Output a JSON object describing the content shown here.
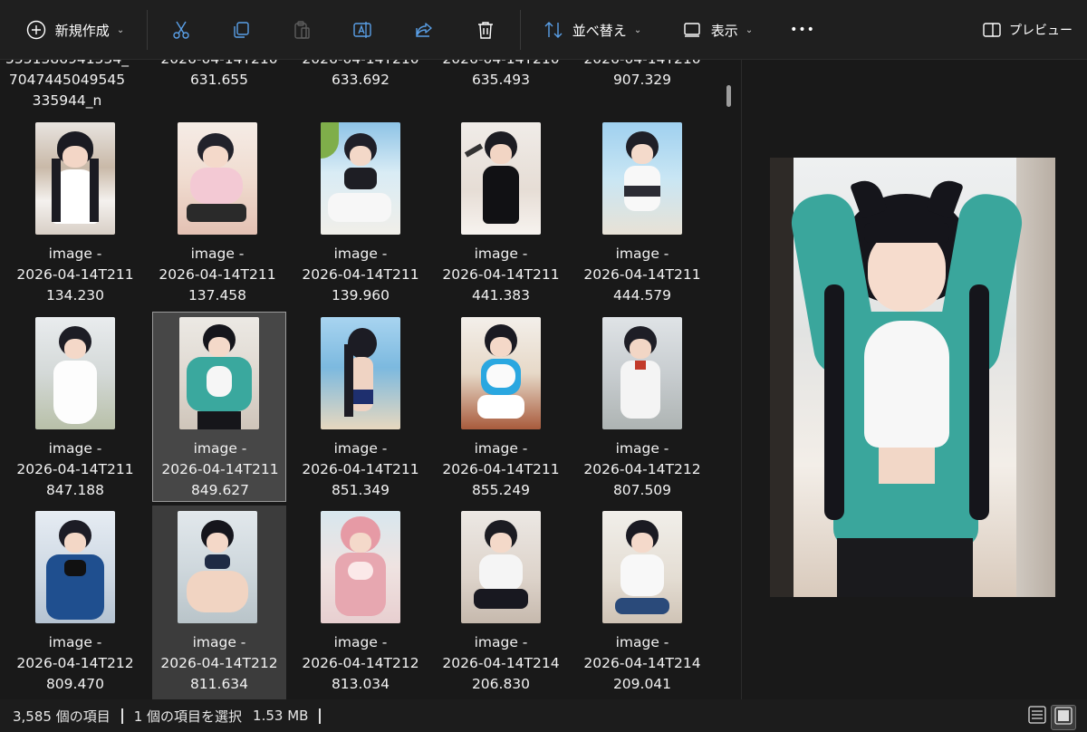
{
  "toolbar": {
    "new_label": "新規作成",
    "sort_label": "並べ替え",
    "view_label": "表示",
    "more_label": "•••",
    "preview_label": "プレビュー"
  },
  "partial_row": [
    {
      "line1": "5551586941554_",
      "line2": "7047445049545",
      "line3": "335944_n"
    },
    {
      "line1": "2026-04-14T210",
      "line2": "631.655"
    },
    {
      "line1": "2026-04-14T210",
      "line2": "633.692"
    },
    {
      "line1": "2026-04-14T210",
      "line2": "635.493"
    },
    {
      "line1": "2026-04-14T210",
      "line2": "907.329"
    }
  ],
  "files": [
    {
      "line1": "image -",
      "line2": "2026-04-14T211",
      "line3": "134.230"
    },
    {
      "line1": "image -",
      "line2": "2026-04-14T211",
      "line3": "137.458"
    },
    {
      "line1": "image -",
      "line2": "2026-04-14T211",
      "line3": "139.960"
    },
    {
      "line1": "image -",
      "line2": "2026-04-14T211",
      "line3": "441.383"
    },
    {
      "line1": "image -",
      "line2": "2026-04-14T211",
      "line3": "444.579"
    },
    {
      "line1": "image -",
      "line2": "2026-04-14T211",
      "line3": "847.188"
    },
    {
      "line1": "image -",
      "line2": "2026-04-14T211",
      "line3": "849.627"
    },
    {
      "line1": "image -",
      "line2": "2026-04-14T211",
      "line3": "851.349"
    },
    {
      "line1": "image -",
      "line2": "2026-04-14T211",
      "line3": "855.249"
    },
    {
      "line1": "image -",
      "line2": "2026-04-14T212",
      "line3": "807.509"
    },
    {
      "line1": "image -",
      "line2": "2026-04-14T212",
      "line3": "809.470"
    },
    {
      "line1": "image -",
      "line2": "2026-04-14T212",
      "line3": "811.634"
    },
    {
      "line1": "image -",
      "line2": "2026-04-14T212",
      "line3": "813.034"
    },
    {
      "line1": "image -",
      "line2": "2026-04-14T214",
      "line3": "206.830"
    },
    {
      "line1": "image -",
      "line2": "2026-04-14T214",
      "line3": "209.041"
    }
  ],
  "status": {
    "item_count": "3,585 個の項目",
    "selection": "1 個の項目を選択",
    "size": "1.53 MB"
  },
  "colors": {
    "background": "#191919",
    "toolbar": "#1f1f1f",
    "selected_tile": "#474747",
    "hover_tile": "#3c3c3c"
  }
}
